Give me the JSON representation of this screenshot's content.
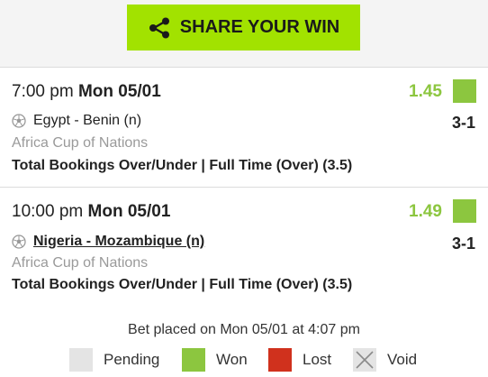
{
  "share": {
    "label": "SHARE YOUR WIN"
  },
  "bets": [
    {
      "time": "7:00 pm",
      "date": "Mon 05/01",
      "odds": "1.45",
      "match": "Egypt - Benin (n)",
      "score": "3-1",
      "competition": "Africa Cup of Nations",
      "market": "Total Bookings Over/Under | Full Time (Over) (3.5)",
      "status": "won"
    },
    {
      "time": "10:00 pm",
      "date": "Mon 05/01",
      "odds": "1.49",
      "match": "Nigeria - Mozambique (n)",
      "score": "3-1",
      "competition": "Africa Cup of Nations",
      "market": "Total Bookings Over/Under | Full Time (Over) (3.5)",
      "status": "won"
    }
  ],
  "footer": {
    "placed_text": "Bet placed on Mon 05/01 at 4:07 pm",
    "legend": [
      {
        "label": "Pending",
        "color": "#e4e4e4"
      },
      {
        "label": "Won",
        "color": "#8cc63f"
      },
      {
        "label": "Lost",
        "color": "#d0311d"
      },
      {
        "label": "Void",
        "color": "#e4e4e4"
      }
    ]
  },
  "colors": {
    "accent": "#a2e200",
    "won": "#8cc63f",
    "lost": "#d0311d",
    "muted": "#9a9a9a"
  }
}
